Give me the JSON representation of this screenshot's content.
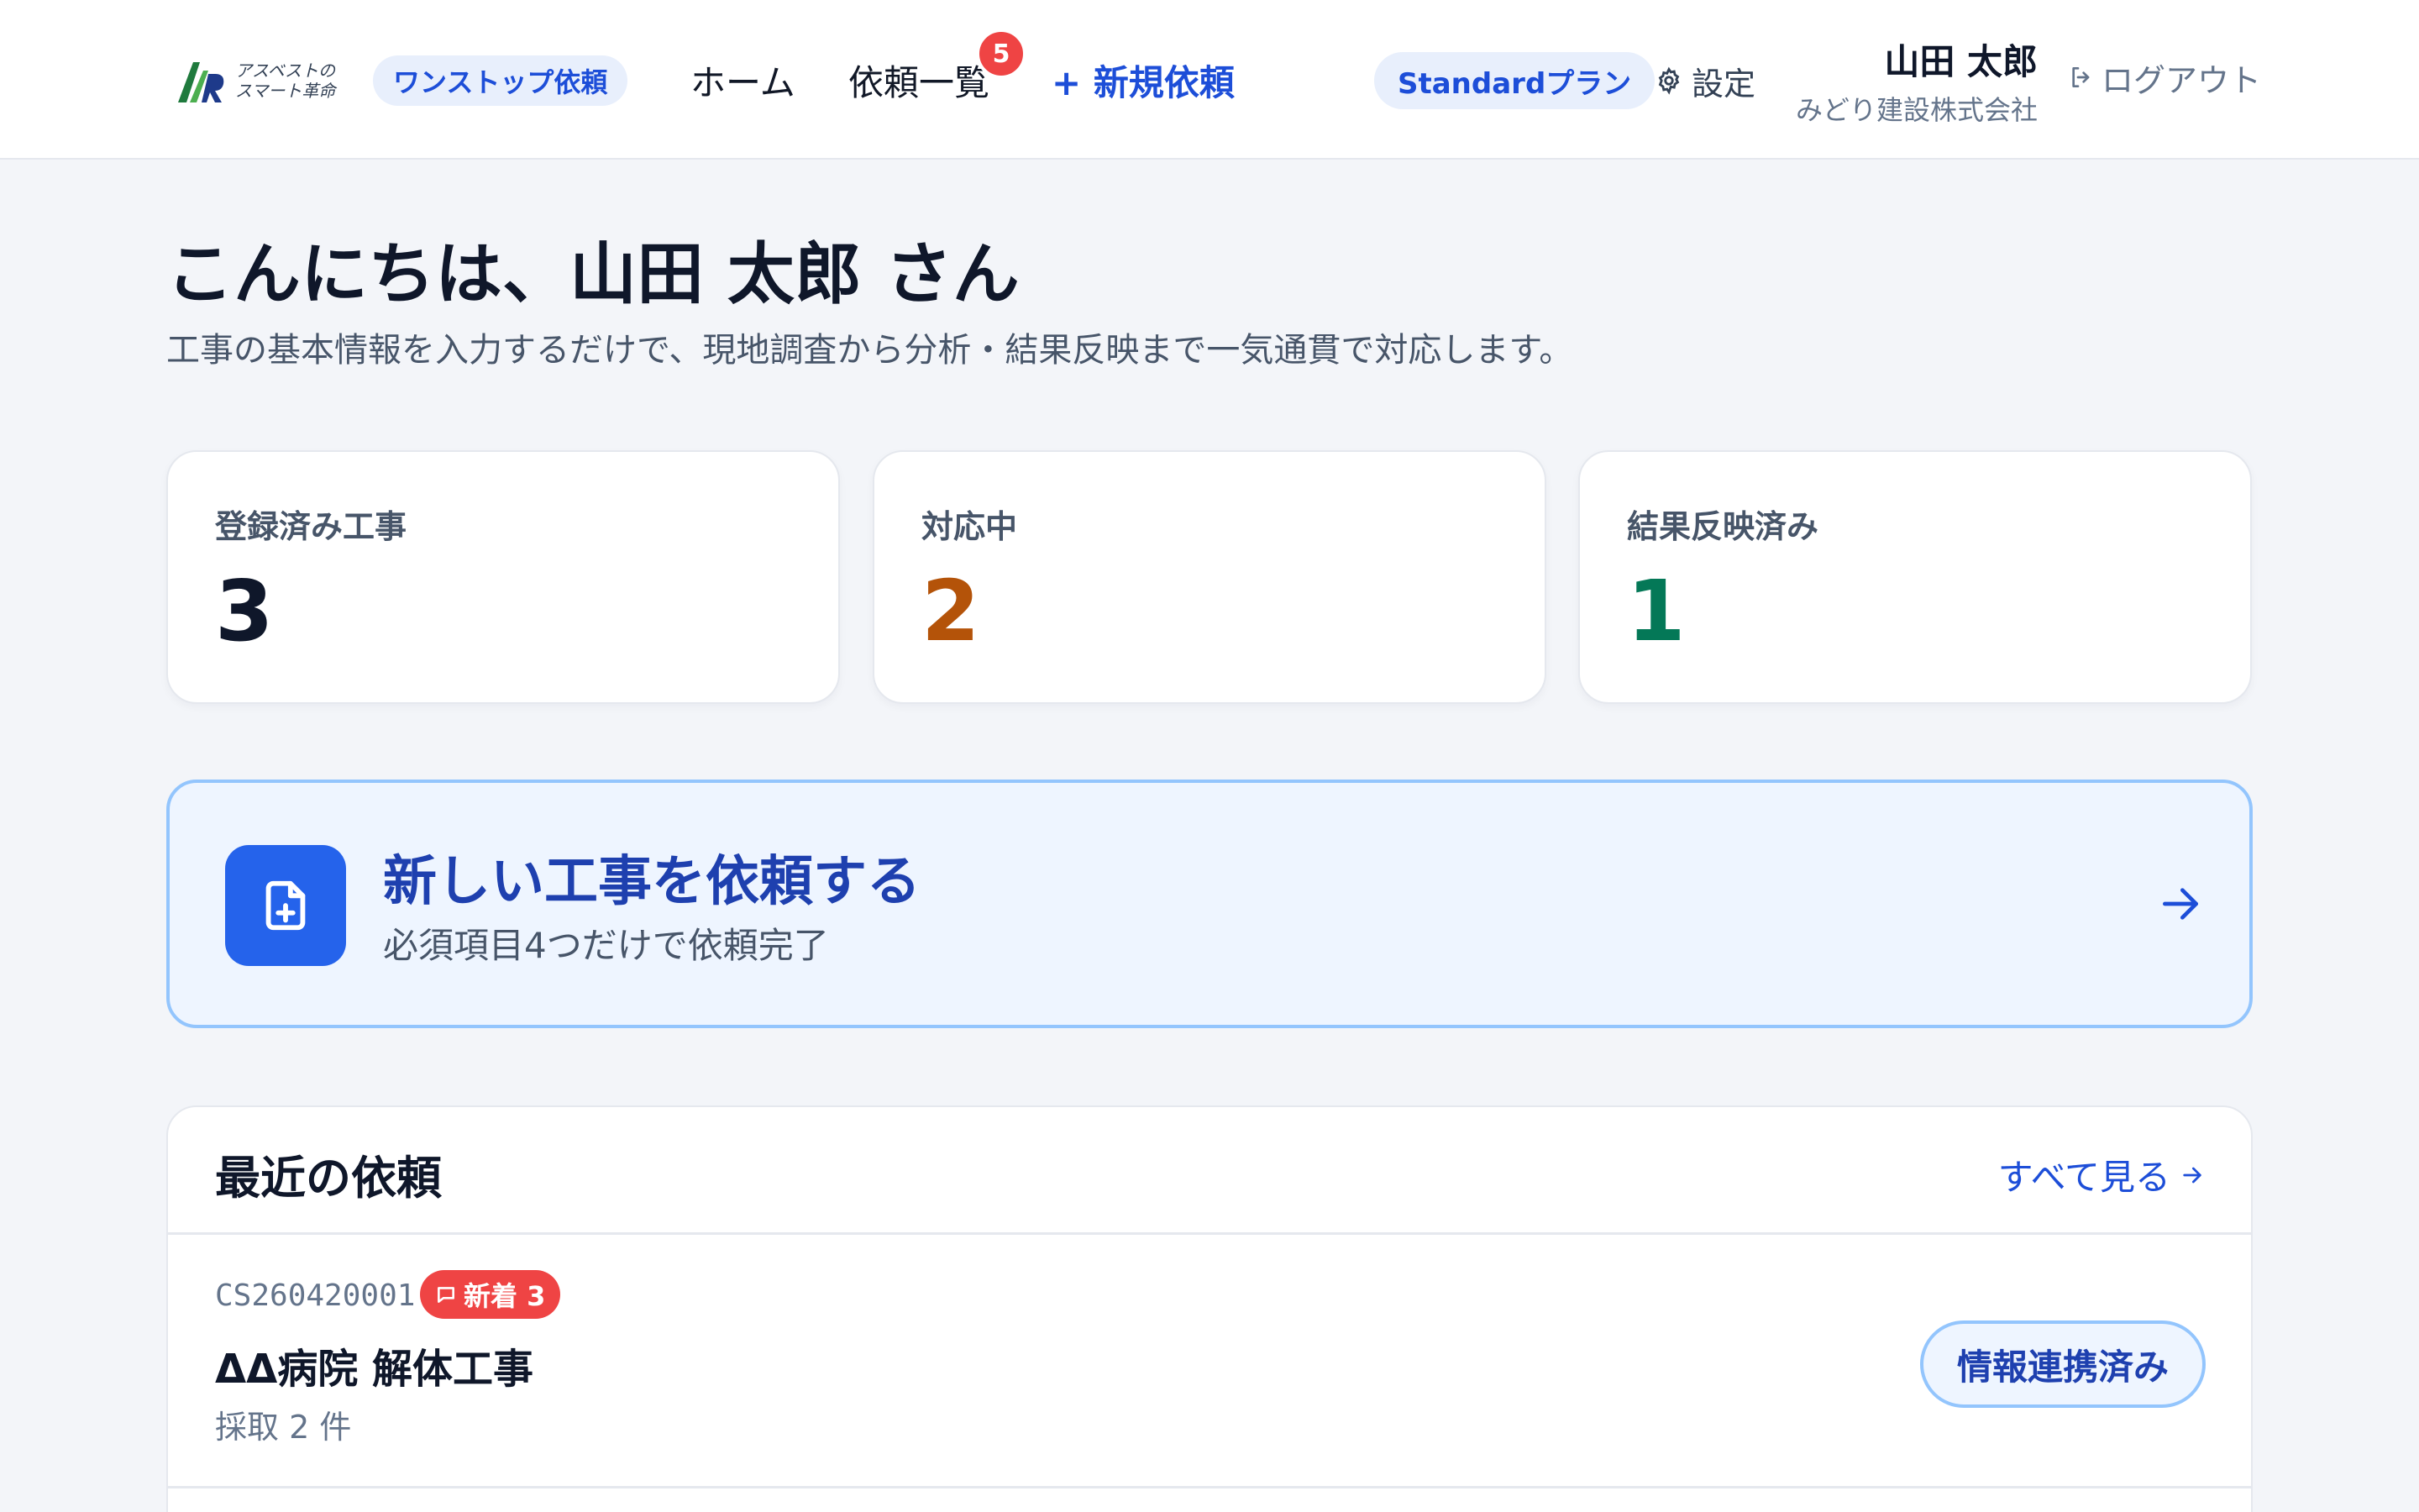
{
  "header": {
    "logo_text_line1": "アスベストの",
    "logo_text_line2": "スマート革命",
    "onestop_label": "ワンストップ依頼",
    "nav": {
      "home": "ホーム",
      "list": "依頼一覧",
      "list_badge": "5",
      "new_request": "+ 新規依頼"
    },
    "plan_label": "Standardプラン",
    "settings_label": "設定",
    "user_name": "山田 太郎",
    "company": "みどり建設株式会社",
    "logout_label": "ログアウト"
  },
  "greeting": {
    "title": "こんにちは、山田 太郎 さん",
    "subtitle": "工事の基本情報を入力するだけで、現地調査から分析・結果反映まで一気通貫で対応します。"
  },
  "stats": [
    {
      "label": "登録済み工事",
      "value": "3",
      "color": "#0f172a"
    },
    {
      "label": "対応中",
      "value": "2",
      "color": "#b45309"
    },
    {
      "label": "結果反映済み",
      "value": "1",
      "color": "#047857"
    }
  ],
  "cta": {
    "title": "新しい工事を依頼する",
    "subtitle": "必須項目4つだけで依頼完了"
  },
  "recent": {
    "title": "最近の依頼",
    "see_all": "すべて見る",
    "rows": [
      {
        "id": "CS260420001",
        "new_badge": "新着 3",
        "title": "ΔΔ病院 解体工事",
        "meta": "採取 2 件",
        "status": "情報連携済み"
      }
    ]
  },
  "colors": {
    "accent": "#1d4ed8",
    "badge_red": "#ef4444",
    "background": "#f3f5f9"
  }
}
